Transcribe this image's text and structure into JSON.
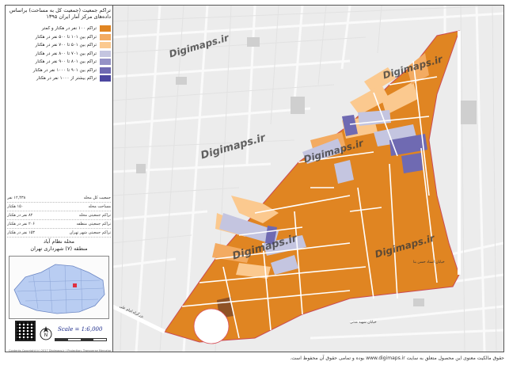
{
  "title": "تراکم جمعیت (جمعیت کل به مساحت) براساس داده‌های مرکز آمار ایران ۱۳۹۵",
  "legend": {
    "items": [
      {
        "label": "تراکم ۱۰۰ نفر در هکتار و کمتر",
        "color": "#e08522"
      },
      {
        "label": "تراکم بین ۱۰۱ تا ۵۰۰ نفر در هکتار",
        "color": "#f3ab62"
      },
      {
        "label": "تراکم بین ۵۰۱ تا ۷۰۰ نفر در هکتار",
        "color": "#fbc98f"
      },
      {
        "label": "تراکم بین ۷۰۱ تا ۸۰۰ نفر در هکتار",
        "color": "#c4c5e0"
      },
      {
        "label": "تراکم بین ۸۰۱ تا ۹۰۰ نفر در هکتار",
        "color": "#9592c6"
      },
      {
        "label": "تراکم بین ۹۰۱ تا ۱۰۰۰ نفر در هکتار",
        "color": "#6f6ab2"
      },
      {
        "label": "تراکم بیشتر از ۱۰۰۰ نفر در هکتار",
        "color": "#4c47a0"
      }
    ]
  },
  "stats": [
    {
      "label": "جمعیت کل محله",
      "value": "۱۲,۴۳۸ نفر"
    },
    {
      "label": "مساحت محله",
      "value": "۱۵۰ هکتار"
    },
    {
      "label": "تراکم جمعیتی محله",
      "value": "۸۲ نفر در هکتار"
    },
    {
      "label": "تراکم جمعیتی منطقه",
      "value": "۲۰۶ نفر در هکتار"
    },
    {
      "label": "تراکم جمعیتی شهر تهران",
      "value": "۱۵۳ نفر در هکتار"
    }
  ],
  "area": {
    "neighborhood": "محله نظام آباد",
    "district": "منطقه (۷) شهرداری تهران"
  },
  "scale_label": "Scale = 1:6,000",
  "credit_small": "Contents Copyright (c) 2017 Digimaps.ir | Projection: Transverse Mercator",
  "watermark": "Digimaps.ir",
  "footer": "حقوق مالکیت معنوی این محصول متعلق به سایت www.digimaps.ir بوده و تمامی حقوق آن محفوظ است.",
  "streets": [
    "بزرگراه امام علی",
    "خیابان استاد حسن بنا",
    "خیابان شهید مدنی"
  ],
  "colors": {
    "road": "#ffffff",
    "background": "#ececec",
    "boundary": "#d8545e"
  }
}
